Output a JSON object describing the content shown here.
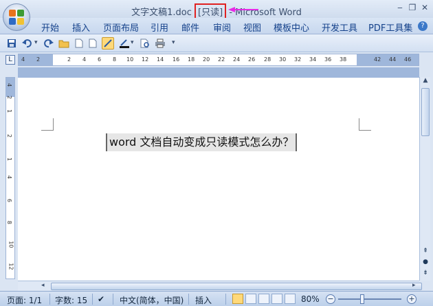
{
  "window": {
    "title_prefix": "文字文稿1.doc ",
    "readonly_badge": "[只读]",
    "title_suffix": "- Microsoft Word",
    "minimize": "‒",
    "restore": "❐",
    "close": "✕"
  },
  "menu": {
    "items": [
      "开始",
      "插入",
      "页面布局",
      "引用",
      "邮件",
      "审阅",
      "视图",
      "模板中心",
      "开发工具",
      "PDF工具集"
    ]
  },
  "ruler": {
    "corner": "L",
    "ticks": [
      "4",
      "2",
      "2",
      "4",
      "6",
      "8",
      "10",
      "12",
      "14",
      "16",
      "18",
      "20",
      "22",
      "24",
      "26",
      "28",
      "30",
      "32",
      "34",
      "36",
      "38",
      "42",
      "44",
      "46"
    ],
    "vticks": [
      "4",
      "2",
      "1",
      "2",
      "1",
      "4",
      "6",
      "8",
      "10",
      "12"
    ]
  },
  "document": {
    "text": "word 文档自动变成只读模式怎么办？"
  },
  "status": {
    "page": "页面: 1/1",
    "words": "字数: 15",
    "language": "中文(简体，中国)",
    "mode": "插入",
    "zoom": "80%",
    "zoom_minus": "−",
    "zoom_plus": "+"
  },
  "colors": {
    "readonly_border": "#e02020",
    "arrow": "#e62be6"
  }
}
